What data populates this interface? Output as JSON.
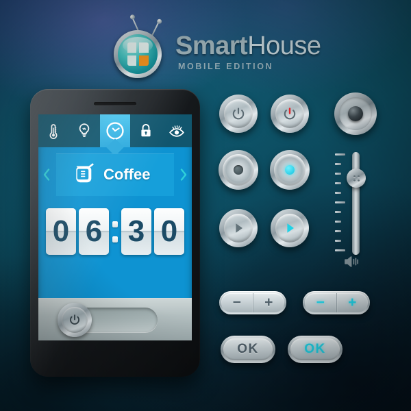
{
  "brand": {
    "name_part1": "Smart",
    "name_part2": "House",
    "tagline": "MOBILE EDITION",
    "logo_icon": "smarthouse-orb-icon",
    "accent_cyan": "#1fd2e6",
    "screen_blue": "#0e93d2",
    "tabbar_blue": "#11566e",
    "card_blue": "#169fda",
    "digit_color": "#1b4b66",
    "red_indicator": "#e0282d",
    "orange_pane": "#f0921e"
  },
  "phone": {
    "tabs": [
      {
        "icon": "thermometer-icon",
        "label": "Climate",
        "active": false
      },
      {
        "icon": "lightbulb-icon",
        "label": "Lighting",
        "active": false
      },
      {
        "icon": "clock-icon",
        "label": "Schedule",
        "active": true
      },
      {
        "icon": "lock-icon",
        "label": "Security",
        "active": false
      },
      {
        "icon": "eye-icon",
        "label": "Surveillance",
        "active": false
      }
    ],
    "device": {
      "label": "Coffee",
      "icon": "coffee-pot-icon",
      "prev_icon": "chevron-left-icon",
      "next_icon": "chevron-right-icon"
    },
    "clock": {
      "hour_d1": "0",
      "hour_d2": "6",
      "separator": ":",
      "minute_d1": "3",
      "minute_d2": "0",
      "display": "06:30"
    },
    "power_toggle": {
      "icon": "power-icon",
      "state": "off",
      "position": "left"
    }
  },
  "controls": {
    "round_buttons": [
      {
        "name": "power-button-gray",
        "icon": "power-icon",
        "style": "gray"
      },
      {
        "name": "power-button-red",
        "icon": "power-icon",
        "style": "red"
      },
      {
        "name": "record-button-gray",
        "icon": "disc-dot-icon",
        "style": "gray"
      },
      {
        "name": "record-button-cyan",
        "icon": "disc-dot-icon",
        "style": "cyan"
      },
      {
        "name": "play-button-gray",
        "icon": "play-icon",
        "style": "gray"
      },
      {
        "name": "play-button-cyan",
        "icon": "play-icon",
        "style": "cyan"
      }
    ],
    "dial": {
      "name": "rotary-dial-knob",
      "icon": "dial-icon"
    },
    "slider": {
      "name": "volume-slider",
      "orientation": "vertical",
      "grip_icon": "slider-grip-icon",
      "speaker_icon": "speaker-volume-icon",
      "tick_count": 11,
      "value_position_pct": 22
    },
    "steppers": [
      {
        "name": "stepper-gray",
        "minus": "−",
        "plus": "+",
        "style": "gray"
      },
      {
        "name": "stepper-cyan",
        "minus": "−",
        "plus": "+",
        "style": "cyan"
      }
    ],
    "ok_buttons": [
      {
        "name": "ok-button-gray",
        "label": "OK",
        "style": "gray"
      },
      {
        "name": "ok-button-cyan",
        "label": "OK",
        "style": "cyan"
      }
    ]
  }
}
